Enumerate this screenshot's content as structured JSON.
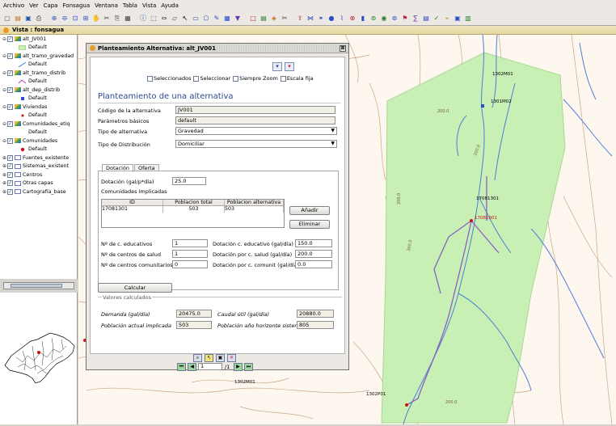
{
  "menu": [
    "Archivo",
    "Ver",
    "Capa",
    "Fonsagua",
    "Ventana",
    "Tabla",
    "Vista",
    "Ayuda"
  ],
  "toolbar_icons": [
    "new-icon",
    "open-icon",
    "save-icon",
    "print-icon",
    "zoom-in-icon",
    "zoom-out-icon",
    "zoom-extent-icon",
    "zoom-all-icon",
    "pan-icon",
    "cut-icon",
    "copy-icon",
    "paste-icon",
    "info-icon",
    "select-icon",
    "measure-icon",
    "area-icon",
    "pointer-icon",
    "select-rect-icon",
    "select-poly-icon",
    "edit-icon",
    "grid-icon",
    "filter-icon",
    "rect-icon",
    "table-icon",
    "layer-icon",
    "scissors-icon",
    "export-icon",
    "join-icon",
    "link-icon",
    "node-icon",
    "pipe-icon",
    "valve-icon",
    "tank-icon",
    "pump-icon",
    "source-icon",
    "network-icon",
    "flag-icon",
    "calc-icon",
    "report-icon",
    "check-icon",
    "graph-icon",
    "save2-icon",
    "sheet-icon"
  ],
  "view_title": "Vista : fonsagua",
  "toc": [
    {
      "indent": 0,
      "exp": "⊖",
      "checked": true,
      "label": "alt_JV001",
      "sym": "layer"
    },
    {
      "indent": 2,
      "exp": "",
      "checked": null,
      "label": "Default",
      "sym": "fill-green"
    },
    {
      "indent": 0,
      "exp": "⊖",
      "checked": true,
      "label": "alt_tramo_gravedad",
      "sym": "layer"
    },
    {
      "indent": 2,
      "exp": "",
      "checked": null,
      "label": "Default",
      "sym": "line-blue"
    },
    {
      "indent": 0,
      "exp": "⊖",
      "checked": true,
      "label": "alt_tramo_distrib",
      "sym": "layer"
    },
    {
      "indent": 2,
      "exp": "",
      "checked": null,
      "label": "Default",
      "sym": "line-purple"
    },
    {
      "indent": 0,
      "exp": "⊖",
      "checked": true,
      "label": "alt_dep_distrib",
      "sym": "layer"
    },
    {
      "indent": 2,
      "exp": "",
      "checked": null,
      "label": "Default",
      "sym": "point-blue"
    },
    {
      "indent": 0,
      "exp": "⊖",
      "checked": true,
      "label": "Viviendas",
      "sym": "layer"
    },
    {
      "indent": 2,
      "exp": "",
      "checked": null,
      "label": "Default",
      "sym": "point-red"
    },
    {
      "indent": 0,
      "exp": "⊖",
      "checked": true,
      "label": "Comunidades_etiq",
      "sym": "layer"
    },
    {
      "indent": 2,
      "exp": "",
      "checked": null,
      "label": "Default",
      "sym": "none"
    },
    {
      "indent": 0,
      "exp": "⊖",
      "checked": true,
      "label": "Comunidades",
      "sym": "layer"
    },
    {
      "indent": 2,
      "exp": "",
      "checked": null,
      "label": "Default",
      "sym": "point-red-big"
    },
    {
      "indent": 0,
      "exp": "⊕",
      "checked": true,
      "label": "Fuentes_existente",
      "sym": "folder"
    },
    {
      "indent": 0,
      "exp": "⊕",
      "checked": true,
      "label": "Sistemas_existent",
      "sym": "folder"
    },
    {
      "indent": 0,
      "exp": "⊕",
      "checked": true,
      "label": "Centros",
      "sym": "folder"
    },
    {
      "indent": 0,
      "exp": "⊕",
      "checked": true,
      "label": "Otras capas",
      "sym": "folder"
    },
    {
      "indent": 0,
      "exp": "⊕",
      "checked": true,
      "label": "Cartografía_base",
      "sym": "folder"
    }
  ],
  "dialog": {
    "title": "Planteamiento Alternativa: alt_JV001",
    "close": "⊠",
    "checks": [
      "Seleccionados",
      "Seleccionar",
      "Siempre Zoom",
      "Escala fija"
    ],
    "heading": "Planteamiento de una alternativa",
    "codigo_label": "Código de la alternativa",
    "codigo_value": "JV001",
    "parametros_label": "Parámetros básicos",
    "parametros_value": "default",
    "tipo_alt_label": "Tipo de alternativa",
    "tipo_alt_value": "Gravedad",
    "tipo_dist_label": "Tipo de Distribución",
    "tipo_dist_value": "Domiciliar",
    "tabs": [
      "Dotación",
      "Oferta"
    ],
    "dotacion_label": "Dotación (gal/p*día)",
    "dotacion_value": "25.0",
    "comunidades_label": "Comunidades implicadas",
    "table_headers": [
      "ID",
      "Poblacion total",
      "Poblacion alternativa"
    ],
    "table_rows": [
      [
        "17081301",
        "503",
        "503"
      ]
    ],
    "add_label": "Añadir",
    "remove_label": "Eliminar",
    "n_edu_label": "Nº de c. educativos",
    "n_edu_value": "1",
    "n_salud_label": "Nº de centros de salud",
    "n_salud_value": "1",
    "n_com_label": "Nº de centros comunitarios",
    "n_com_value": "0",
    "dot_edu_label": "Dotación c. educativo (gal/día)",
    "dot_edu_value": "150.0",
    "dot_salud_label": "Dotación por c. salud (gal/día)",
    "dot_salud_value": "200.0",
    "dot_com_label": "Dotación por c. comunit (gal/día)",
    "dot_com_value": "0.0",
    "calc_label": "Calcular",
    "group_label": "Valores calculados",
    "demanda_label": "Demanda (gal/día)",
    "demanda_value": "20475.0",
    "caudal_label": "Caudal útil (gal/día)",
    "caudal_value": "20880.0",
    "pob_actual_label": "Población actual implicada",
    "pob_actual_value": "503",
    "pob_horiz_label": "Población año horizonte sistema",
    "pob_horiz_value": "805",
    "nav_page": "1",
    "nav_total": "/1"
  },
  "map_labels": {
    "a": "1302M01",
    "b": "1301M02",
    "c": "17081301",
    "d": "1302M01",
    "e": "1302P01",
    "f": "17081301",
    "g": "200.0",
    "h": "200.0",
    "i": "200.0",
    "j": "200.0",
    "k": "300.0",
    "l": "400.0",
    "m": "200.0",
    "n": "300.0",
    "o": "200.0"
  },
  "colors": {
    "polygon": "#c8f0b4",
    "river": "#4a7fd8",
    "pipe": "#8a5fc4",
    "contour": "#c9a78a",
    "accent": "#2d4b8e"
  }
}
